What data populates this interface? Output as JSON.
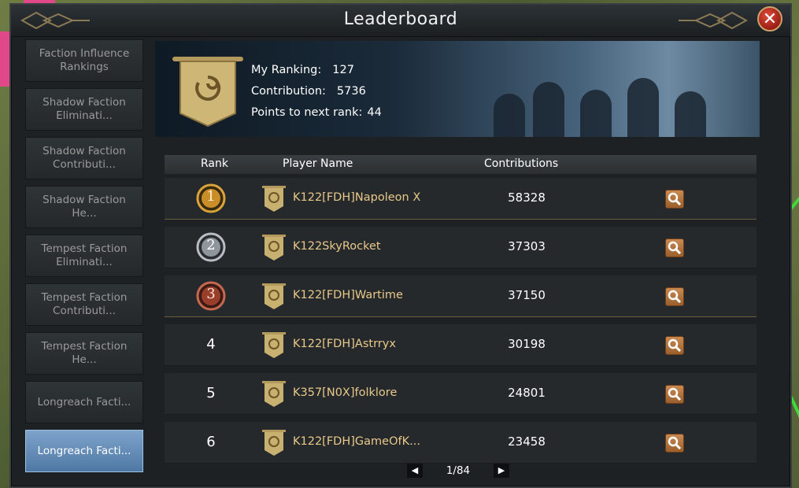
{
  "window": {
    "title": "Leaderboard"
  },
  "sidebar": {
    "items": [
      {
        "label": "Faction Influence Rankings",
        "active": false
      },
      {
        "label": "Shadow Faction Eliminati...",
        "active": false
      },
      {
        "label": "Shadow Faction Contributi...",
        "active": false
      },
      {
        "label": "Shadow Faction He...",
        "active": false
      },
      {
        "label": "Tempest Faction Eliminati...",
        "active": false
      },
      {
        "label": "Tempest Faction Contributi...",
        "active": false
      },
      {
        "label": "Tempest Faction He...",
        "active": false
      },
      {
        "label": "Longreach Facti...",
        "active": false
      },
      {
        "label": "Longreach Facti...",
        "active": true
      }
    ]
  },
  "banner": {
    "my_ranking_label": "My Ranking:",
    "my_ranking_value": "127",
    "contribution_label": "Contribution:",
    "contribution_value": "5736",
    "points_label": "Points to next rank:",
    "points_value": "44"
  },
  "table": {
    "headers": {
      "rank": "Rank",
      "player": "Player Name",
      "contributions": "Contributions"
    },
    "rows": [
      {
        "rank": "1",
        "medal": "gold",
        "player": "K122[FDH]Napoleon X",
        "contribution": "58328"
      },
      {
        "rank": "2",
        "medal": "silver",
        "player": "K122SkyRocket",
        "contribution": "37303"
      },
      {
        "rank": "3",
        "medal": "bronze",
        "player": "K122[FDH]Wartime",
        "contribution": "37150"
      },
      {
        "rank": "4",
        "medal": null,
        "player": "K122[FDH]Astrryx",
        "contribution": "30198"
      },
      {
        "rank": "5",
        "medal": null,
        "player": "K357[N0X]folklore",
        "contribution": "24801"
      },
      {
        "rank": "6",
        "medal": null,
        "player": "K122[FDH]GameOfK...",
        "contribution": "23458"
      }
    ]
  },
  "pager": {
    "text": "1/84"
  },
  "colors": {
    "accent_gold": "#e9c98a",
    "active_tab": "#6f97c2",
    "close": "#c0392b"
  },
  "icons": {
    "close": "close-icon",
    "banner": "faction-banner-icon",
    "view": "magnifier-icon",
    "prev": "triangle-left-icon",
    "next": "triangle-right-icon"
  }
}
